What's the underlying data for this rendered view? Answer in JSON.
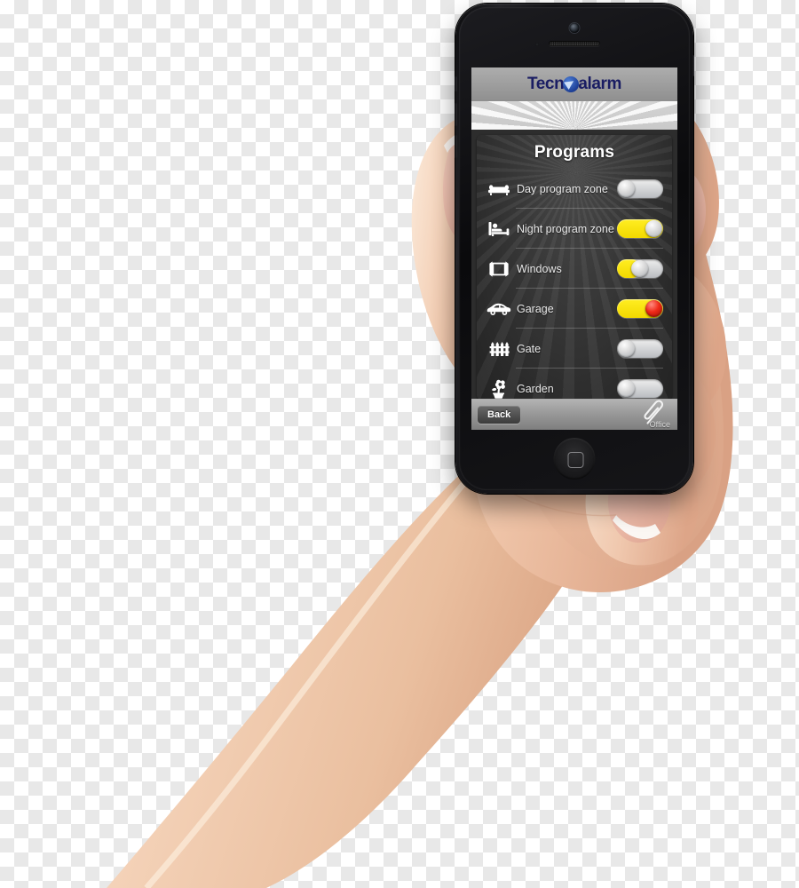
{
  "device": {
    "name": "smartphone",
    "home_button": "home-button",
    "front_camera": "front-camera-icon",
    "earpiece": "earpiece-speaker"
  },
  "app": {
    "brand": {
      "prefix": "Tecn",
      "mark": "blue-arrow-circle-logo-mark",
      "suffix": "alarm"
    },
    "panel_title": "Programs",
    "colors": {
      "accent_yellow": "#f2d900",
      "alarm_red": "#ef2a18",
      "brand_navy": "#1a1d63",
      "panel_dark": "#333333",
      "toolbar_gray": "#9b9b9b"
    },
    "rows": [
      {
        "label": "Day program zone",
        "icon": "sofa-icon",
        "state": "off",
        "fill_percent": 0,
        "knob_percent": 0,
        "knob_color": "gray"
      },
      {
        "label": "Night program zone",
        "icon": "bed-icon",
        "state": "on",
        "fill_percent": 100,
        "knob_percent": 100,
        "knob_color": "gray"
      },
      {
        "label": "Windows",
        "icon": "window-icon",
        "state": "partial",
        "fill_percent": 52,
        "knob_percent": 50,
        "knob_color": "gray"
      },
      {
        "label": "Garage",
        "icon": "car-icon",
        "state": "alarm",
        "fill_percent": 100,
        "knob_percent": 100,
        "knob_color": "red"
      },
      {
        "label": "Gate",
        "icon": "fence-icon",
        "state": "off",
        "fill_percent": 0,
        "knob_percent": 0,
        "knob_color": "gray"
      },
      {
        "label": "Garden",
        "icon": "flower-icon",
        "state": "off",
        "fill_percent": 0,
        "knob_percent": 0,
        "knob_color": "gray"
      }
    ],
    "toolbar": {
      "back_label": "Back",
      "attachment_icon": "paperclip-icon",
      "attachment_label": "Office"
    }
  }
}
